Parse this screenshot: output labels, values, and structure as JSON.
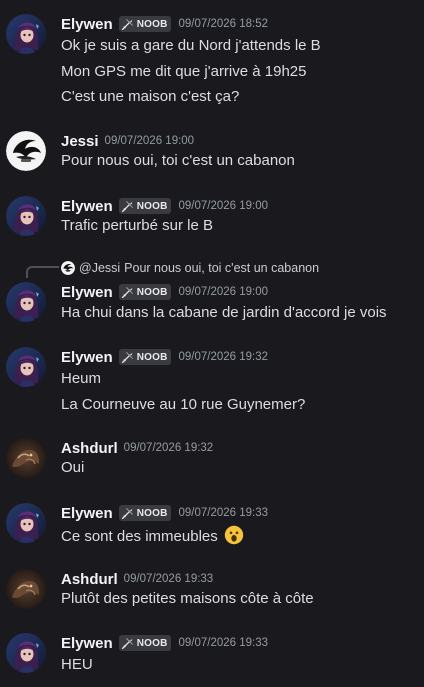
{
  "messages": [
    {
      "username": "Elywen",
      "tag": "NOOB",
      "timestamp": "09/07/2026 18:52",
      "lines": [
        "Ok je suis a gare du Nord j'attends le B",
        "Mon GPS me dit que j'arrive à 19h25",
        "C'est une maison c'est ça?"
      ]
    },
    {
      "username": "Jessi",
      "timestamp": "09/07/2026 19:00",
      "lines": [
        "Pour nous oui, toi c'est un cabanon"
      ]
    },
    {
      "username": "Elywen",
      "tag": "NOOB",
      "timestamp": "09/07/2026 19:00",
      "lines": [
        "Trafic perturbé sur le B"
      ]
    },
    {
      "reply": {
        "author": "@Jessi",
        "text": "Pour nous oui, toi c'est un cabanon"
      },
      "username": "Elywen",
      "tag": "NOOB",
      "timestamp": "09/07/2026 19:00",
      "lines": [
        "Ha chui dans la cabane de jardin d'accord je vois"
      ]
    },
    {
      "username": "Elywen",
      "tag": "NOOB",
      "timestamp": "09/07/2026 19:32",
      "lines": [
        "Heum",
        "La Courneuve au 10 rue Guynemer?"
      ]
    },
    {
      "username": "Ashdurl",
      "timestamp": "09/07/2026 19:32",
      "lines": [
        "Oui"
      ]
    },
    {
      "username": "Elywen",
      "tag": "NOOB",
      "timestamp": "09/07/2026 19:33",
      "lines": [
        "Ce sont des immeubles"
      ],
      "emoji": "astonished-face-emoji"
    },
    {
      "username": "Ashdurl",
      "timestamp": "09/07/2026 19:33",
      "lines": [
        "Plutôt des petites maisons côte à côte"
      ]
    },
    {
      "username": "Elywen",
      "tag": "NOOB",
      "timestamp": "09/07/2026 19:33",
      "lines": [
        "HEU"
      ]
    }
  ],
  "colors": {
    "background": "#1a1a1e",
    "username": "#f2f3f5",
    "message_text": "#dbdee1",
    "timestamp": "#949ba4",
    "tag_background": "#3a3b41"
  }
}
